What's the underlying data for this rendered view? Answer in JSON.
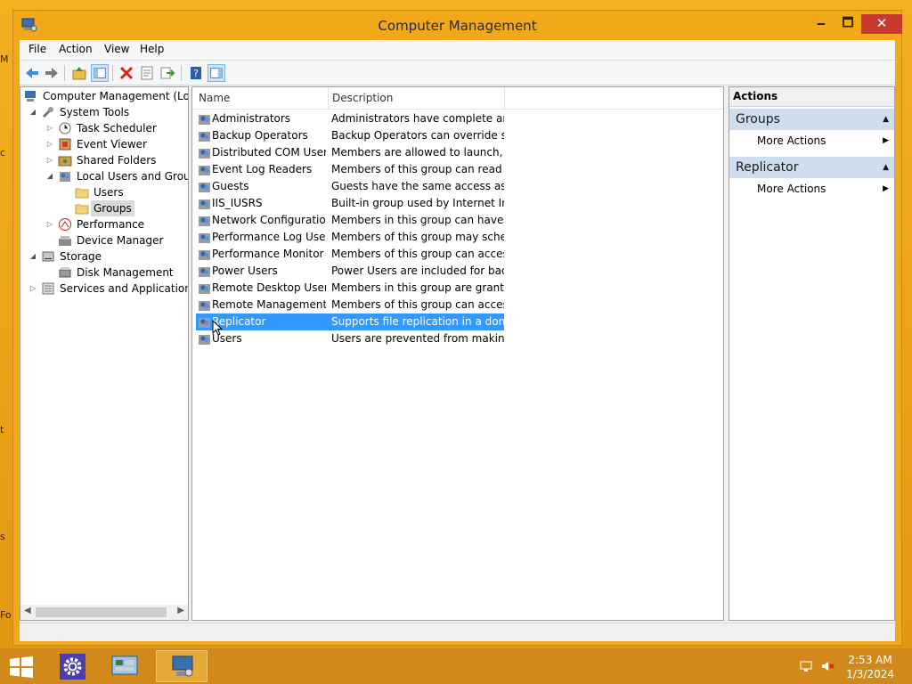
{
  "window": {
    "title": "Computer Management",
    "minimize": "🗕",
    "maximize": "🗖",
    "close": "✕"
  },
  "menu": [
    "File",
    "Action",
    "View",
    "Help"
  ],
  "tree": {
    "root": "Computer Management (Local",
    "system_tools": "System Tools",
    "task_scheduler": "Task Scheduler",
    "event_viewer": "Event Viewer",
    "shared_folders": "Shared Folders",
    "local_users_groups": "Local Users and Groups",
    "users": "Users",
    "groups": "Groups",
    "performance": "Performance",
    "device_manager": "Device Manager",
    "storage": "Storage",
    "disk_management": "Disk Management",
    "services_apps": "Services and Applications"
  },
  "list": {
    "columns": {
      "name": "Name",
      "description": "Description"
    },
    "rows": [
      {
        "name": "Administrators",
        "description": "Administrators have complete an..."
      },
      {
        "name": "Backup Operators",
        "description": "Backup Operators can override se..."
      },
      {
        "name": "Distributed COM Users",
        "description": "Members are allowed to launch, a..."
      },
      {
        "name": "Event Log Readers",
        "description": "Members of this group can read e..."
      },
      {
        "name": "Guests",
        "description": "Guests have the same access as m..."
      },
      {
        "name": "IIS_IUSRS",
        "description": "Built-in group used by Internet Inf..."
      },
      {
        "name": "Network Configuratio...",
        "description": "Members in this group can have s..."
      },
      {
        "name": "Performance Log Users",
        "description": "Members of this group may sche..."
      },
      {
        "name": "Performance Monitor ...",
        "description": "Members of this group can acces..."
      },
      {
        "name": "Power Users",
        "description": "Power Users are included for back..."
      },
      {
        "name": "Remote Desktop Users",
        "description": "Members in this group are grante..."
      },
      {
        "name": "Remote Management...",
        "description": "Members of this group can acces..."
      },
      {
        "name": "Replicator",
        "description": "Supports file replication in a dom..."
      },
      {
        "name": "Users",
        "description": "Users are prevented from making ..."
      }
    ],
    "selected_index": 12
  },
  "actions": {
    "header": "Actions",
    "sections": [
      {
        "title": "Groups",
        "item": "More Actions"
      },
      {
        "title": "Replicator",
        "item": "More Actions"
      }
    ]
  },
  "taskbar": {
    "time": "2:53 AM",
    "date": "1/3/2024"
  },
  "desktop_edge_letters": [
    "M",
    "c",
    "t",
    "s",
    "Fo"
  ],
  "colors": {
    "accent_orange": "#f1a91a",
    "selection_blue": "#3399ff",
    "close_red": "#c7382e",
    "action_header": "#cfdeee"
  }
}
